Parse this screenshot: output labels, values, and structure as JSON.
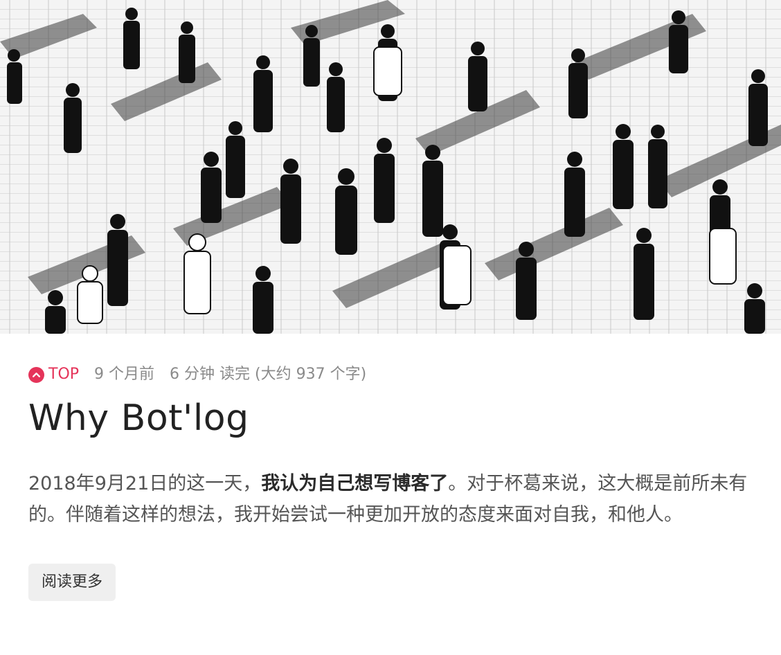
{
  "cover": {
    "alt": "black-and-white crowd illustration"
  },
  "meta": {
    "top_label": "TOP",
    "time_ago": "9 个月前",
    "read_time": "6 分钟 读完 (大约 937 个字)"
  },
  "post": {
    "title": "Why Bot'log",
    "excerpt_start": "2018年9月21日的这一天，",
    "excerpt_bold": "我认为自己想写博客了",
    "excerpt_end": "。对于杯葛来说，这大概是前所未有的。伴随着这样的想法，我开始尝试一种更加开放的态度来面对自我，和他人。"
  },
  "actions": {
    "read_more_label": "阅读更多"
  },
  "colors": {
    "accent": "#e5345a",
    "meta_text": "#8a8a8a",
    "button_bg": "#efefef"
  }
}
